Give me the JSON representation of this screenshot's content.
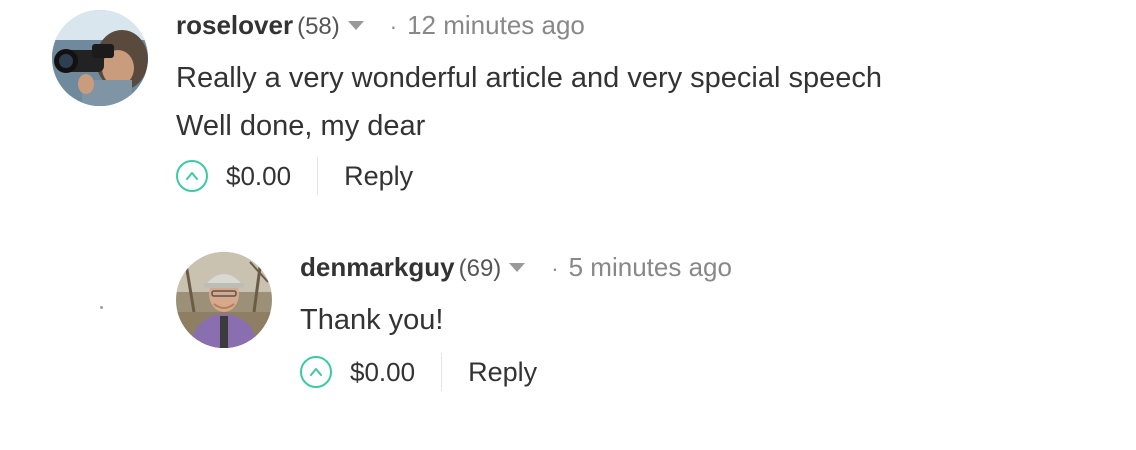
{
  "comments": [
    {
      "username": "roselover",
      "reputation": "(58)",
      "separator": "·",
      "time": "12 minutes ago",
      "lines": [
        "Really a very wonderful article and very special speech",
        "Well done, my dear"
      ],
      "payout": "$0.00",
      "reply_label": "Reply",
      "avatar_icon": "photographer-with-camera-avatar"
    },
    {
      "username": "denmarkguy",
      "reputation": "(69)",
      "separator": "·",
      "time": "5 minutes ago",
      "lines": [
        "Thank you!"
      ],
      "payout": "$0.00",
      "reply_label": "Reply",
      "avatar_icon": "man-with-cap-avatar"
    }
  ],
  "colors": {
    "upvote_accent": "#3cc9a4",
    "text": "#333333",
    "muted": "#888888"
  }
}
